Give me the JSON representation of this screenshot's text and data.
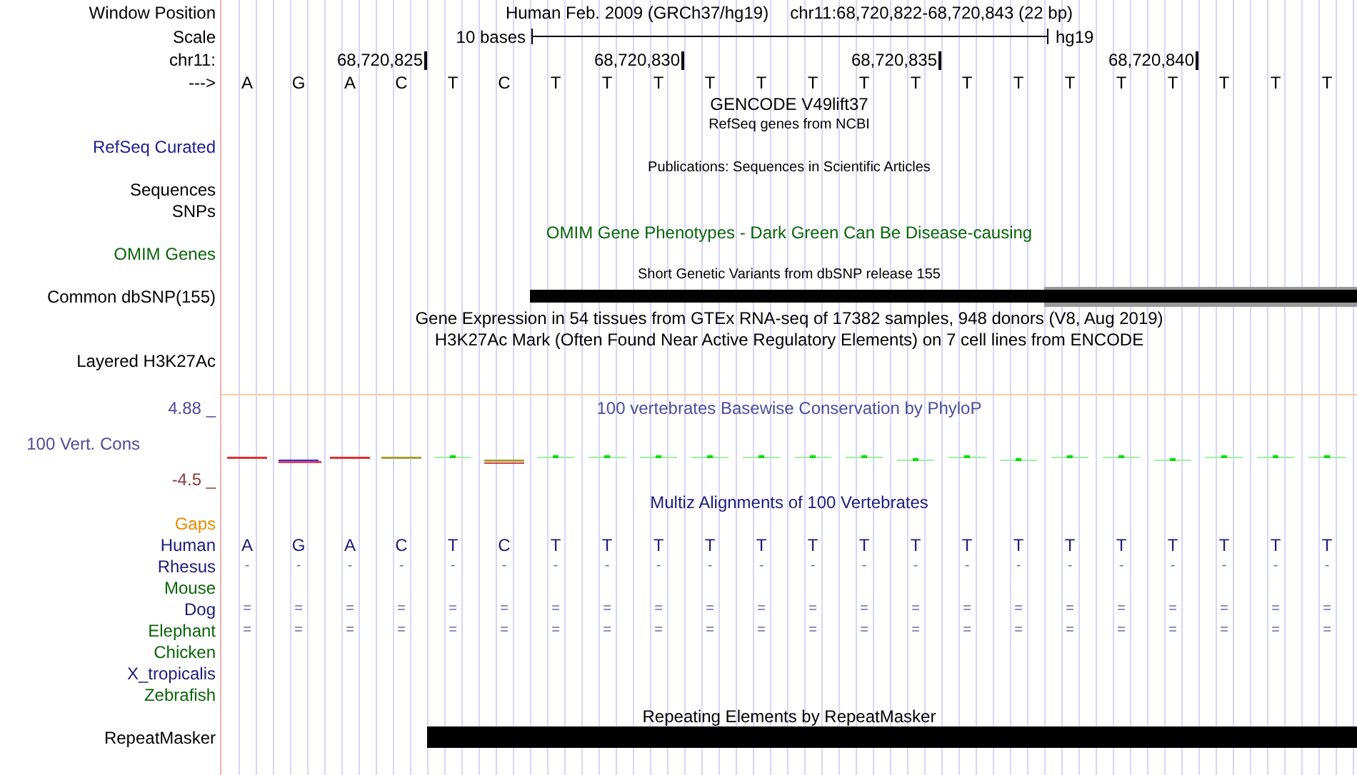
{
  "window_position": {
    "label": "Window Position",
    "assembly": "Human Feb. 2009 (GRCh37/hg19)",
    "range": "chr11:68,720,822-68,720,843 (22 bp)"
  },
  "scale": {
    "label": "Scale",
    "length": "10 bases",
    "assembly": "hg19"
  },
  "ruler": {
    "label": "chr11:",
    "ticks": [
      "68,720,825",
      "68,720,830",
      "68,720,835",
      "68,720,840"
    ]
  },
  "sequence": {
    "label": "--->",
    "bases": [
      "A",
      "G",
      "A",
      "C",
      "T",
      "C",
      "T",
      "T",
      "T",
      "T",
      "T",
      "T",
      "T",
      "T",
      "T",
      "T",
      "T",
      "T",
      "T",
      "T",
      "T",
      "T"
    ]
  },
  "tracks": [
    {
      "kind": "text",
      "title": {
        "text": "GENCODE V49lift37",
        "small": false
      }
    },
    {
      "kind": "text",
      "title": {
        "text": "RefSeq genes from NCBI",
        "small": true
      },
      "label": "RefSeq Curated",
      "color": "#1c1c8c"
    },
    {
      "kind": "text",
      "title": {
        "text": "Publications: Sequences in Scientific Articles",
        "small": true
      },
      "label": "Sequences",
      "color": "#000000"
    },
    {
      "kind": "text",
      "label": "SNPs",
      "color": "#000000"
    },
    {
      "kind": "text",
      "title": {
        "text": "OMIM Gene Phenotypes - Dark Green Can Be Disease-causing",
        "small": false,
        "color": "#0a640a"
      },
      "label": "OMIM Genes",
      "color": "#0a640a"
    },
    {
      "kind": "variant-bar",
      "title": {
        "text": "Short Genetic Variants from dbSNP release 155",
        "small": true
      },
      "label": "Common dbSNP(155)",
      "color": "#000000"
    },
    {
      "kind": "text",
      "title": {
        "text": "Gene Expression in 54 tissues from GTEx RNA-seq of 17382 samples, 948 donors (V8, Aug 2019)",
        "small": false
      }
    },
    {
      "kind": "text",
      "title": {
        "text": "H3K27Ac Mark (Often Found Near Active Regulatory Elements) on 7 cell lines from ENCODE",
        "small": false
      },
      "label": "Layered H3K27Ac",
      "color": "#000000"
    }
  ],
  "conservation": {
    "title": "100 vertebrates Basewise Conservation by PhyloP",
    "label": "100 Vert. Cons",
    "max": "4.88 _",
    "min": "-4.5 _"
  },
  "multiz": {
    "title": "Multiz Alignments of 100 Vertebrates",
    "gaps_label": "Gaps",
    "reference": {
      "name": "Human",
      "color": "#1c1c78",
      "bases": [
        "A",
        "G",
        "A",
        "C",
        "T",
        "C",
        "T",
        "T",
        "T",
        "T",
        "T",
        "T",
        "T",
        "T",
        "T",
        "T",
        "T",
        "T",
        "T",
        "T",
        "T",
        "T"
      ]
    },
    "species": [
      {
        "name": "Rhesus",
        "color": "#1c1c78",
        "bases": [
          "-",
          "-",
          "-",
          "-",
          "-",
          "-",
          "-",
          "-",
          "-",
          "-",
          "-",
          "-",
          "-",
          "-",
          "-",
          "-",
          "-",
          "-",
          "-",
          "-",
          "-",
          "-"
        ]
      },
      {
        "name": "Mouse",
        "color": "#0c640c"
      },
      {
        "name": "Dog",
        "color": "#1c1c78",
        "bases": [
          "=",
          "=",
          "=",
          "=",
          "=",
          "=",
          "=",
          "=",
          "=",
          "=",
          "=",
          "=",
          "=",
          "=",
          "=",
          "=",
          "=",
          "=",
          "=",
          "=",
          "=",
          "="
        ]
      },
      {
        "name": "Elephant",
        "color": "#0c640c",
        "bases": [
          "=",
          "=",
          "=",
          "=",
          "=",
          "=",
          "=",
          "=",
          "=",
          "=",
          "=",
          "=",
          "=",
          "=",
          "=",
          "=",
          "=",
          "=",
          "=",
          "=",
          "=",
          "="
        ]
      },
      {
        "name": "Chicken",
        "color": "#0c640c"
      },
      {
        "name": "X_tropicalis",
        "color": "#1c1c78"
      },
      {
        "name": "Zebrafish",
        "color": "#0c640c"
      }
    ]
  },
  "repeatmasker": {
    "title": "Repeating Elements by RepeatMasker",
    "label": "RepeatMasker"
  }
}
